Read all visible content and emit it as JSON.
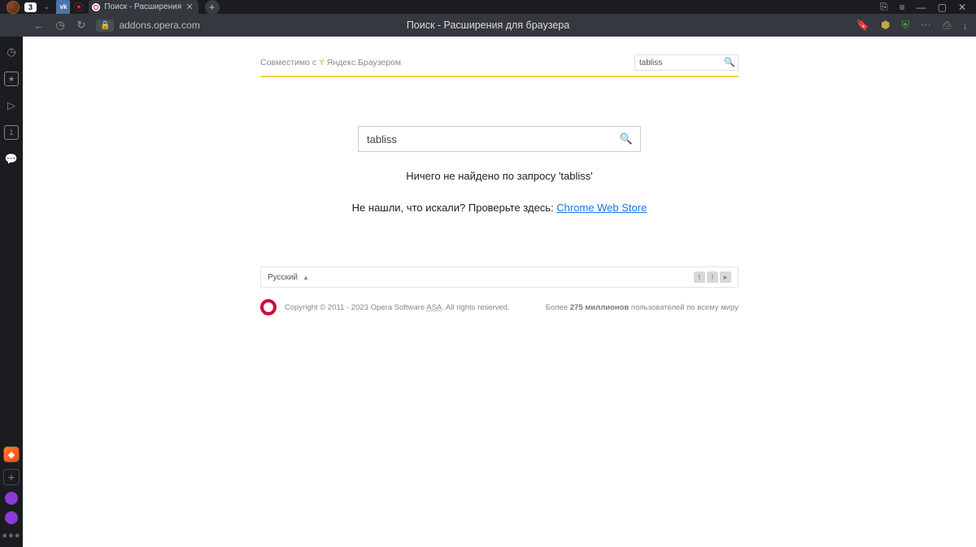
{
  "browser": {
    "tab_count": "3",
    "active_tab_title": "Поиск - Расширения д",
    "url": "addons.opera.com",
    "page_title": "Поиск - Расширения для браузера"
  },
  "header": {
    "compat_prefix": "Совместимо с",
    "compat_brand": "Яндекс.Браузером",
    "top_search_value": "tabliss"
  },
  "main": {
    "search_value": "tabliss",
    "not_found": "Ничего не найдено по запросу 'tabliss'",
    "suggest_prefix": "Не нашли, что искали? Проверьте здесь: ",
    "suggest_link": "Chrome Web Store"
  },
  "footer": {
    "language": "Русский",
    "copyright_prefix": "Copyright © 2011 - 2023 Opera Software ",
    "asa": "ASA",
    "copyright_suffix": ". All rights reserved.",
    "users_prefix": "Более ",
    "users_bold": "275 миллионов",
    "users_suffix": " пользователей по всему миру"
  }
}
